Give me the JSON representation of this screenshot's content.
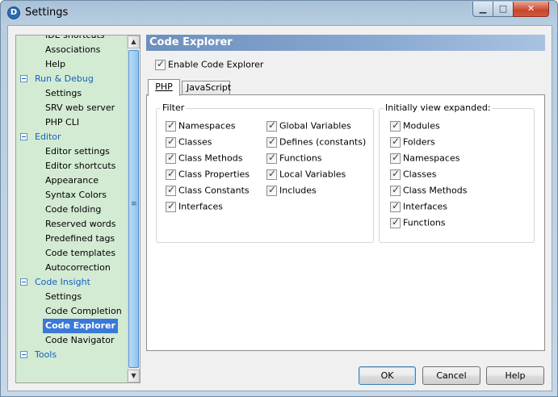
{
  "window": {
    "title": "Settings"
  },
  "tree": {
    "items": [
      {
        "label": "IDE shortcuts",
        "type": "child"
      },
      {
        "label": "Associations",
        "type": "child"
      },
      {
        "label": "Help",
        "type": "child"
      },
      {
        "label": "Run & Debug",
        "type": "category"
      },
      {
        "label": "Settings",
        "type": "child"
      },
      {
        "label": "SRV web server",
        "type": "child"
      },
      {
        "label": "PHP CLI",
        "type": "child"
      },
      {
        "label": "Editor",
        "type": "category"
      },
      {
        "label": "Editor settings",
        "type": "child"
      },
      {
        "label": "Editor shortcuts",
        "type": "child"
      },
      {
        "label": "Appearance",
        "type": "child"
      },
      {
        "label": "Syntax Colors",
        "type": "child"
      },
      {
        "label": "Code folding",
        "type": "child"
      },
      {
        "label": "Reserved words",
        "type": "child"
      },
      {
        "label": "Predefined tags",
        "type": "child"
      },
      {
        "label": "Code templates",
        "type": "child"
      },
      {
        "label": "Autocorrection",
        "type": "child"
      },
      {
        "label": "Code Insight",
        "type": "category"
      },
      {
        "label": "Settings",
        "type": "child"
      },
      {
        "label": "Code Completion",
        "type": "child"
      },
      {
        "label": "Code Explorer",
        "type": "child",
        "selected": true
      },
      {
        "label": "Code Navigator",
        "type": "child"
      },
      {
        "label": "Tools",
        "type": "category"
      }
    ]
  },
  "panel": {
    "header": "Code Explorer",
    "enable_label": "Enable Code Explorer",
    "tabs": [
      {
        "label": "PHP",
        "active": true
      },
      {
        "label": "JavaScript",
        "active": false
      }
    ],
    "filter": {
      "title": "Filter",
      "col1": [
        "Namespaces",
        "Classes",
        "Class Methods",
        "Class Properties",
        "Class Constants",
        "Interfaces"
      ],
      "col2": [
        "Global Variables",
        "Defines (constants)",
        "Functions",
        "Local Variables",
        "Includes"
      ]
    },
    "expanded": {
      "title": "Initially view expanded:",
      "items": [
        "Modules",
        "Folders",
        "Namespaces",
        "Classes",
        "Class Methods",
        "Interfaces",
        "Functions"
      ]
    }
  },
  "buttons": {
    "ok": "OK",
    "cancel": "Cancel",
    "help": "Help"
  },
  "colors": {
    "tree_bg": "#d3ebd3",
    "category": "#1560c0",
    "selected": "#3b78d8",
    "header": "#7b9bc7"
  }
}
